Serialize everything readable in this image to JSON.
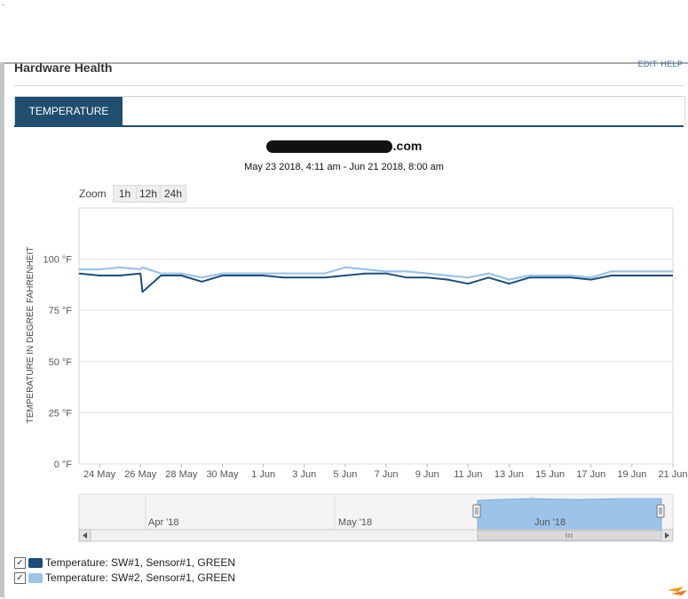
{
  "widget": {
    "title": "Hardware Health",
    "edit_label": "EDIT",
    "help_label": "HELP",
    "tab_label": "TEMPERATURE",
    "host_suffix": ".com",
    "date_range": "May 23 2018, 4:11 am - Jun 21 2018, 8:00 am"
  },
  "zoom": {
    "label": "Zoom",
    "buttons": [
      "1h",
      "12h",
      "24h"
    ]
  },
  "navigator": {
    "labels": [
      "Apr '18",
      "May '18",
      "Jun '18"
    ]
  },
  "chart_data": {
    "type": "line",
    "ylabel": "TEMPERATURE IN DEGREE FAHRENHEIT",
    "ylim": [
      0,
      125
    ],
    "yticks": [
      "0 °F",
      "25 °F",
      "50 °F",
      "75 °F",
      "100 °F"
    ],
    "xlim": [
      "2018-05-23",
      "2018-06-21"
    ],
    "xticks": [
      "24 May",
      "26 May",
      "28 May",
      "30 May",
      "1 Jun",
      "3 Jun",
      "5 Jun",
      "7 Jun",
      "9 Jun",
      "11 Jun",
      "13 Jun",
      "15 Jun",
      "17 Jun",
      "19 Jun",
      "21 Jun"
    ],
    "grid": true,
    "legend_position": "bottom-left",
    "x": [
      "2018-05-23",
      "2018-05-24",
      "2018-05-25",
      "2018-05-26",
      "2018-05-26",
      "2018-05-27",
      "2018-05-28",
      "2018-05-29",
      "2018-05-30",
      "2018-05-31",
      "2018-06-01",
      "2018-06-02",
      "2018-06-03",
      "2018-06-04",
      "2018-06-05",
      "2018-06-06",
      "2018-06-07",
      "2018-06-08",
      "2018-06-09",
      "2018-06-10",
      "2018-06-11",
      "2018-06-12",
      "2018-06-13",
      "2018-06-14",
      "2018-06-15",
      "2018-06-16",
      "2018-06-17",
      "2018-06-18",
      "2018-06-19",
      "2018-06-20",
      "2018-06-21"
    ],
    "series": [
      {
        "name": "Temperature: SW#1, Sensor#1, GREEN",
        "color": "#1a4d7c",
        "values": [
          93,
          92,
          92,
          93,
          84,
          92,
          92,
          89,
          92,
          92,
          92,
          91,
          91,
          91,
          92,
          93,
          93,
          91,
          91,
          90,
          88,
          91,
          88,
          91,
          91,
          91,
          90,
          92,
          92,
          92,
          92
        ]
      },
      {
        "name": "Temperature: SW#2, Sensor#1, GREEN",
        "color": "#9cc3e8",
        "values": [
          95,
          95,
          96,
          95,
          96,
          93,
          93,
          91,
          93,
          93,
          93,
          93,
          93,
          93,
          96,
          95,
          94,
          94,
          93,
          92,
          91,
          93,
          90,
          92,
          92,
          92,
          91,
          94,
          94,
          94,
          94
        ]
      }
    ]
  }
}
